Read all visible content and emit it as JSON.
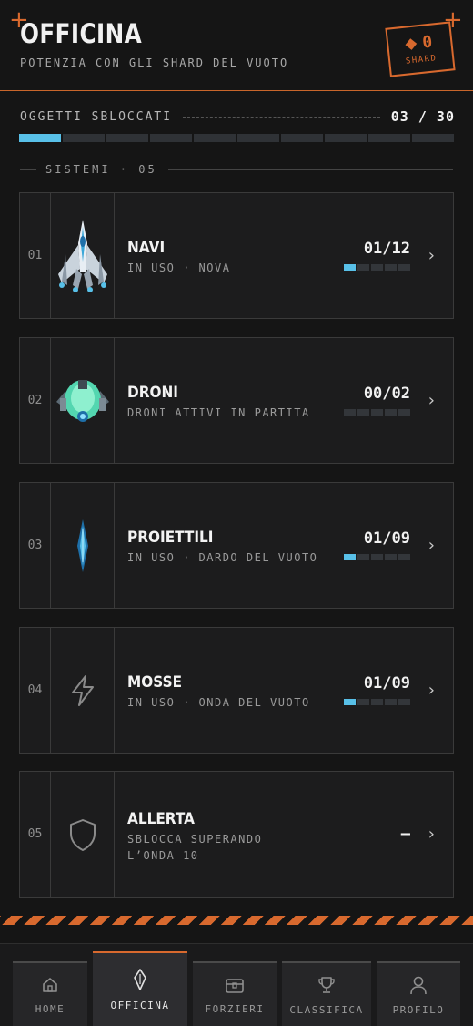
{
  "header": {
    "title": "OFFICINA",
    "subtitle": "POTENZIA CON GLI SHARD DEL VUOTO",
    "shard_count": "0",
    "shard_label": "SHARD",
    "accent_color": "#d8692e"
  },
  "progress": {
    "label": "OGGETTI SBLOCCATI",
    "count": "03 / 30",
    "unlocked": 3,
    "total": 30
  },
  "section": {
    "label": "SISTEMI · 05"
  },
  "systems": [
    {
      "index": "01",
      "name": "NAVI",
      "sub": "IN USO · NOVA",
      "count": "01/12",
      "level": 1,
      "icon": "ship-image"
    },
    {
      "index": "02",
      "name": "DRONI",
      "sub": "DRONI ATTIVI IN PARTITA",
      "count": "00/02",
      "level": 0,
      "icon": "drone-image"
    },
    {
      "index": "03",
      "name": "PROIETTILI",
      "sub": "IN USO · DARDO DEL VUOTO",
      "count": "01/09",
      "level": 1,
      "icon": "projectile-image"
    },
    {
      "index": "04",
      "name": "MOSSE",
      "sub": "IN USO · ONDA DEL VUOTO",
      "count": "01/09",
      "level": 1,
      "icon": "lightning-icon"
    },
    {
      "index": "05",
      "name": "ALLERTA",
      "sub_line1": "SBLOCCA SUPERANDO",
      "sub_line2": "L’ONDA 10",
      "count": "–",
      "icon": "shield-icon"
    }
  ],
  "nav": [
    {
      "label": "HOME",
      "icon": "home-icon",
      "active": false
    },
    {
      "label": "OFFICINA",
      "icon": "crystal-icon",
      "active": true
    },
    {
      "label": "FORZIERI",
      "icon": "chest-icon",
      "active": false
    },
    {
      "label": "CLASSIFICA",
      "icon": "trophy-icon",
      "active": false
    },
    {
      "label": "PROFILO",
      "icon": "user-icon",
      "active": false
    }
  ],
  "colors": {
    "progress_fill": "#58c0e8",
    "background": "#151515"
  }
}
